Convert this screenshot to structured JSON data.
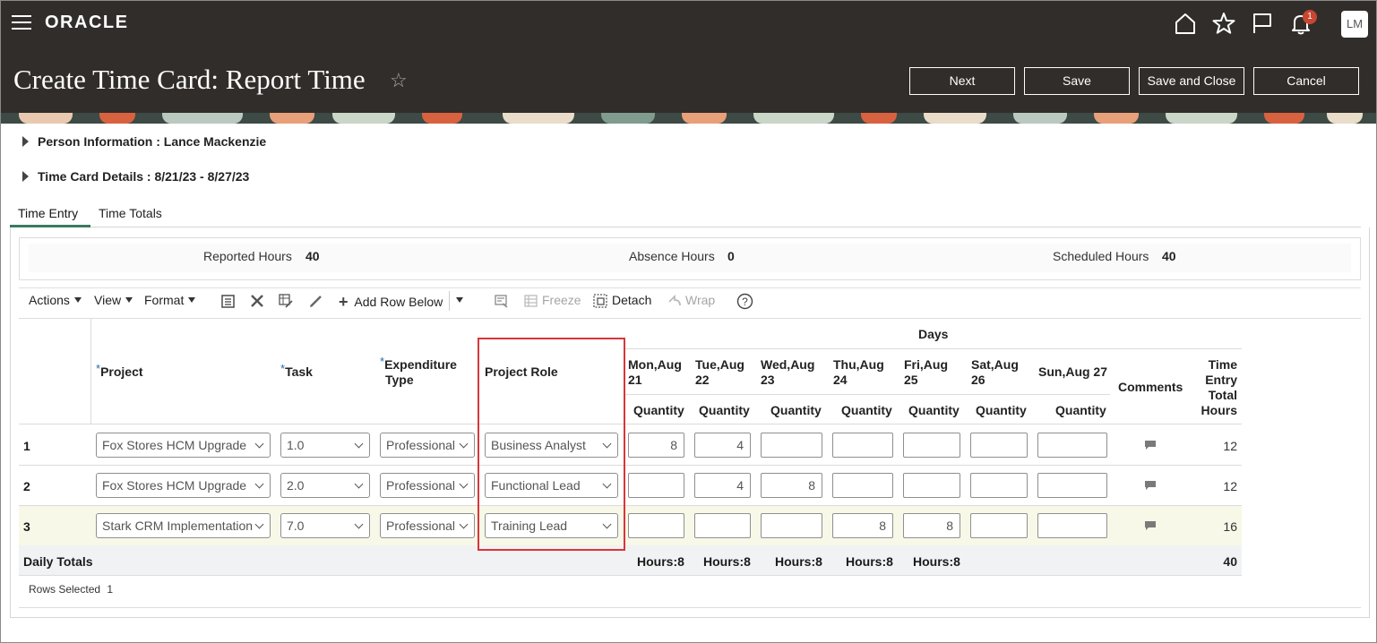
{
  "header": {
    "brand": "ORACLE",
    "notification_count": "1",
    "avatar_initials": "LM",
    "page_title": "Create Time Card: Report Time",
    "buttons": {
      "next": "Next",
      "save": "Save",
      "save_close": "Save and Close",
      "cancel": "Cancel"
    }
  },
  "sections": {
    "person_info": "Person Information : Lance Mackenzie",
    "time_card_details": "Time Card Details : 8/21/23 - 8/27/23"
  },
  "tabs": [
    "Time Entry",
    "Time Totals"
  ],
  "active_tab": "Time Entry",
  "summary": {
    "reported_label": "Reported Hours",
    "reported_value": "40",
    "absence_label": "Absence Hours",
    "absence_value": "0",
    "scheduled_label": "Scheduled Hours",
    "scheduled_value": "40"
  },
  "toolbar": {
    "actions": "Actions",
    "view": "View",
    "format": "Format",
    "add_row_below": "Add Row Below",
    "freeze": "Freeze",
    "detach": "Detach",
    "wrap": "Wrap"
  },
  "table": {
    "days_group": "Days",
    "col_project": "Project",
    "col_task": "Task",
    "col_expenditure_1": "Expenditure",
    "col_expenditure_2": "Type",
    "col_role": "Project Role",
    "days": [
      {
        "l1": "Mon,Aug",
        "l2": "21"
      },
      {
        "l1": "Tue,Aug",
        "l2": "22"
      },
      {
        "l1": "Wed,Aug",
        "l2": "23"
      },
      {
        "l1": "Thu,Aug",
        "l2": "24"
      },
      {
        "l1": "Fri,Aug",
        "l2": "25"
      },
      {
        "l1": "Sat,Aug",
        "l2": "26"
      },
      {
        "l1": "Sun,Aug 27",
        "l2": ""
      }
    ],
    "quantity_label": "Quantity",
    "col_comments": "Comments",
    "col_total_1": "Time",
    "col_total_2": "Entry",
    "col_total_3": "Total",
    "col_total_4": "Hours",
    "rows": [
      {
        "num": "1",
        "project": "Fox Stores HCM Upgrade",
        "task": "1.0",
        "exp": "Professional",
        "role": "Business Analyst",
        "q": [
          "8",
          "4",
          "",
          "",
          "",
          "",
          ""
        ],
        "total": "12"
      },
      {
        "num": "2",
        "project": "Fox Stores HCM Upgrade",
        "task": "2.0",
        "exp": "Professional",
        "role": "Functional Lead",
        "q": [
          "",
          "4",
          "8",
          "",
          "",
          "",
          ""
        ],
        "total": "12"
      },
      {
        "num": "3",
        "project": "Stark CRM Implementation",
        "task": "7.0",
        "exp": "Professional",
        "role": "Training Lead",
        "q": [
          "",
          "",
          "",
          "8",
          "8",
          "",
          ""
        ],
        "total": "16"
      }
    ],
    "daily_totals_label": "Daily Totals",
    "daily_totals": [
      "Hours:8",
      "Hours:8",
      "Hours:8",
      "Hours:8",
      "Hours:8"
    ],
    "grand_total": "40",
    "rows_selected_label": "Rows Selected",
    "rows_selected_value": "1"
  },
  "colors": {
    "header_bg": "#312d2a",
    "active_tab": "#3a7a5e",
    "selected_row": "#f8f8e8",
    "highlight": "#d9353a"
  }
}
